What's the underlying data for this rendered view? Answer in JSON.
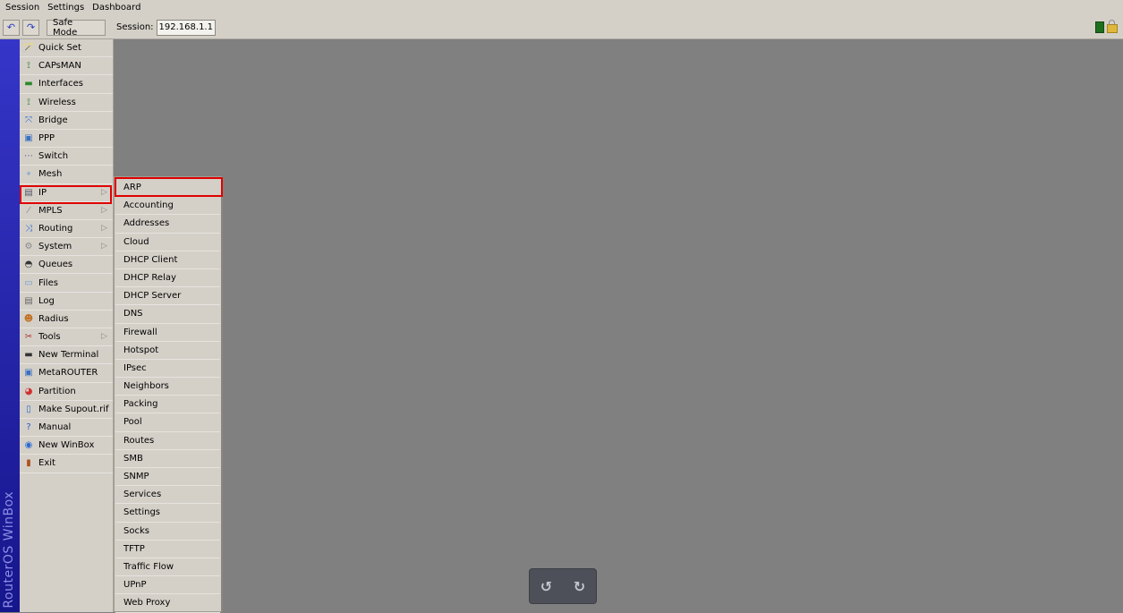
{
  "menubar": {
    "items": [
      "Session",
      "Settings",
      "Dashboard"
    ]
  },
  "toolbar": {
    "undo_icon": "↶",
    "redo_icon": "↷",
    "safe_mode_label": "Safe Mode",
    "session_label": "Session:",
    "session_value": "192.168.1.1",
    "status_color": "#1e6e1e"
  },
  "brand": {
    "text": "RouterOS WinBox",
    "color": "#2a2ab4"
  },
  "sidebar": {
    "items": [
      {
        "label": "Quick Set",
        "icon": "quick-set-icon",
        "glyph": "🪄",
        "submenu": false
      },
      {
        "label": "CAPsMAN",
        "icon": "capsman-icon",
        "glyph": "⟟",
        "submenu": false
      },
      {
        "label": "Interfaces",
        "icon": "interfaces-icon",
        "glyph": "▬",
        "submenu": false
      },
      {
        "label": "Wireless",
        "icon": "wireless-icon",
        "glyph": "⟟",
        "submenu": false
      },
      {
        "label": "Bridge",
        "icon": "bridge-icon",
        "glyph": "⤧",
        "submenu": false
      },
      {
        "label": "PPP",
        "icon": "ppp-icon",
        "glyph": "▣",
        "submenu": false
      },
      {
        "label": "Switch",
        "icon": "switch-icon",
        "glyph": "⋯",
        "submenu": false
      },
      {
        "label": "Mesh",
        "icon": "mesh-icon",
        "glyph": "∘",
        "submenu": false
      },
      {
        "label": "IP",
        "icon": "ip-icon",
        "glyph": "▤",
        "submenu": true
      },
      {
        "label": "MPLS",
        "icon": "mpls-icon",
        "glyph": "⁄",
        "submenu": true
      },
      {
        "label": "Routing",
        "icon": "routing-icon",
        "glyph": "⤨",
        "submenu": true
      },
      {
        "label": "System",
        "icon": "system-icon",
        "glyph": "⚙",
        "submenu": true
      },
      {
        "label": "Queues",
        "icon": "queues-icon",
        "glyph": "◓",
        "submenu": false
      },
      {
        "label": "Files",
        "icon": "files-icon",
        "glyph": "▭",
        "submenu": false
      },
      {
        "label": "Log",
        "icon": "log-icon",
        "glyph": "▤",
        "submenu": false
      },
      {
        "label": "Radius",
        "icon": "radius-icon",
        "glyph": "☻",
        "submenu": false
      },
      {
        "label": "Tools",
        "icon": "tools-icon",
        "glyph": "✂",
        "submenu": true
      },
      {
        "label": "New Terminal",
        "icon": "terminal-icon",
        "glyph": "▬",
        "submenu": false
      },
      {
        "label": "MetaROUTER",
        "icon": "metarouter-icon",
        "glyph": "▣",
        "submenu": false
      },
      {
        "label": "Partition",
        "icon": "partition-icon",
        "glyph": "◕",
        "submenu": false
      },
      {
        "label": "Make Supout.rif",
        "icon": "supout-icon",
        "glyph": "▯",
        "submenu": false
      },
      {
        "label": "Manual",
        "icon": "manual-icon",
        "glyph": "?",
        "submenu": false
      },
      {
        "label": "New WinBox",
        "icon": "winbox-icon",
        "glyph": "◉",
        "submenu": false
      },
      {
        "label": "Exit",
        "icon": "exit-icon",
        "glyph": "▮",
        "submenu": false
      }
    ],
    "highlighted": "IP"
  },
  "ip_submenu": {
    "items": [
      "ARP",
      "Accounting",
      "Addresses",
      "Cloud",
      "DHCP Client",
      "DHCP Relay",
      "DHCP Server",
      "DNS",
      "Firewall",
      "Hotspot",
      "IPsec",
      "Neighbors",
      "Packing",
      "Pool",
      "Routes",
      "SMB",
      "SNMP",
      "Services",
      "Settings",
      "Socks",
      "TFTP",
      "Traffic Flow",
      "UPnP",
      "Web Proxy"
    ],
    "highlighted": "ARP"
  },
  "floating_controls": {
    "rotate_left_icon": "↺",
    "rotate_right_icon": "↻"
  },
  "colors": {
    "highlight": "#e00000",
    "workspace": "#808080"
  }
}
